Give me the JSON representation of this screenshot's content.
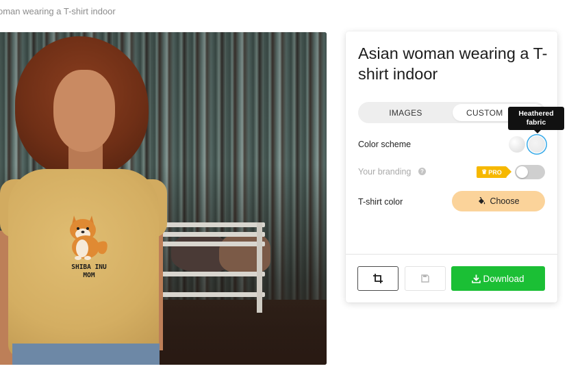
{
  "breadcrumb": {
    "text": "oman wearing a T-shirt indoor"
  },
  "mockup": {
    "alt": "Woman with curly hair wearing a Shiba Inu Mom T-shirt indoors",
    "print_text": [
      "SHIBA INU",
      "MOM"
    ]
  },
  "panel": {
    "title": "Asian woman wearing a T-shirt indoor",
    "tabs": [
      {
        "label": "IMAGES",
        "active": false
      },
      {
        "label": "CUSTOM",
        "active": true
      }
    ],
    "color_scheme": {
      "label": "Color scheme",
      "options": [
        {
          "name": "solid",
          "selected": false
        },
        {
          "name": "heathered",
          "selected": true
        }
      ],
      "tooltip_line1": "Heathered",
      "tooltip_line2": "fabric"
    },
    "branding": {
      "label": "Your branding",
      "help_icon": "?",
      "pro_label": "PRO",
      "crown_icon": "♛",
      "enabled": false
    },
    "tshirt_color": {
      "label": "T-shirt color",
      "button_label": "Choose",
      "button_icon": "paint-bucket-icon",
      "button_color": "#fbd39a"
    },
    "actions": {
      "crop_icon": "crop-icon",
      "save_icon": "floppy-disk-icon",
      "download_label": "Download",
      "download_color": "#1bbf35"
    }
  }
}
